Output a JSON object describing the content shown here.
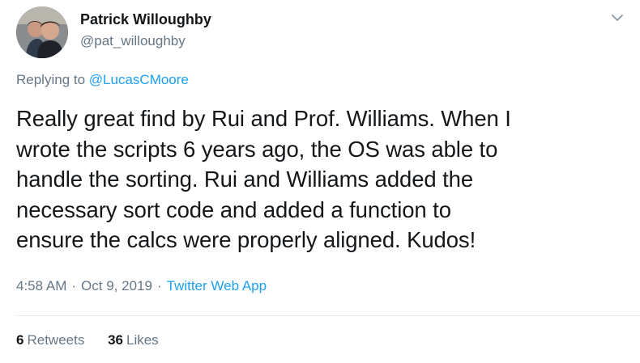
{
  "tweet": {
    "author": {
      "name": "Patrick Willoughby",
      "handle": "@pat_willoughby"
    },
    "reply": {
      "prefix": "Replying to",
      "mention": "@LucasCMoore"
    },
    "text_lines": [
      "Really great find by Rui and Prof. Williams. When I",
      "wrote the scripts 6 years ago, the OS was able to",
      "handle the sorting. Rui and Williams added the",
      "necessary sort code and added a function to",
      "ensure the calcs were properly aligned. Kudos!"
    ],
    "meta": {
      "time": "4:58 AM",
      "separator": "·",
      "date": "Oct 9, 2019",
      "source": "Twitter Web App"
    },
    "stats": {
      "retweets_count": "6",
      "retweets_label": "Retweets",
      "likes_count": "36",
      "likes_label": "Likes"
    }
  },
  "icons": {
    "caret": "chevron-down-icon",
    "avatar": "avatar"
  },
  "colors": {
    "text": "#14171a",
    "secondary": "#657786",
    "link": "#1da1f2",
    "divider": "#e6ecf0"
  }
}
